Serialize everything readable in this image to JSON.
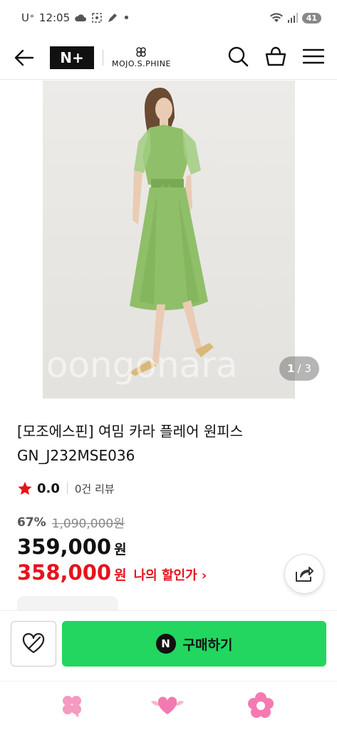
{
  "status_bar": {
    "carrier": "U⁺",
    "time": "12:05",
    "battery": "41"
  },
  "header": {
    "nplus_label": "N+",
    "brand_name": "MOJO.S.PHINE"
  },
  "gallery": {
    "watermark": "Joongonara",
    "counter_current": "1",
    "counter_total": "/ 3"
  },
  "product": {
    "title": "[모조에스핀] 여밈 카라 플레어 원피스 GN_J232MSE036",
    "rating": "0.0",
    "review_count": "0건 리뷰",
    "discount_rate": "67%",
    "original_price": "1,090,000원",
    "price": "359,000",
    "price_unit": "원",
    "my_price": "358,000",
    "my_price_unit": "원",
    "my_price_link": "나의 할인가 ›"
  },
  "bottom_bar": {
    "buy_badge": "N",
    "buy_label": "구매하기"
  },
  "colors": {
    "accent_green": "#22d65f",
    "price_red": "#e5131d",
    "star": "#e5131d"
  }
}
